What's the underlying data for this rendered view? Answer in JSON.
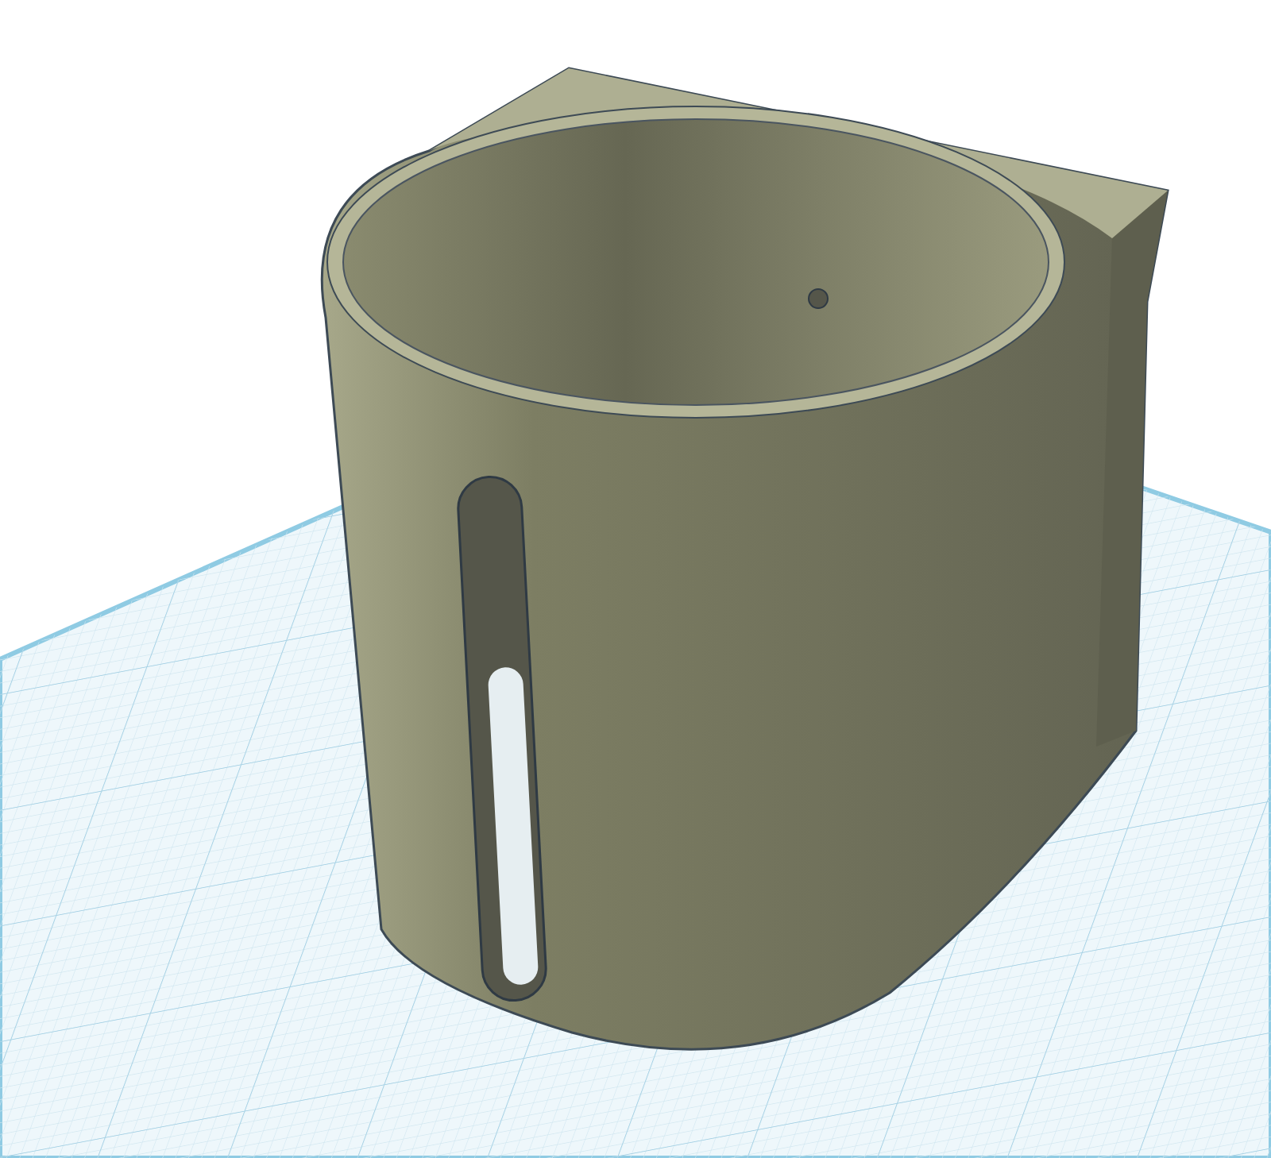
{
  "viewport": {
    "kind": "workplane"
  }
}
